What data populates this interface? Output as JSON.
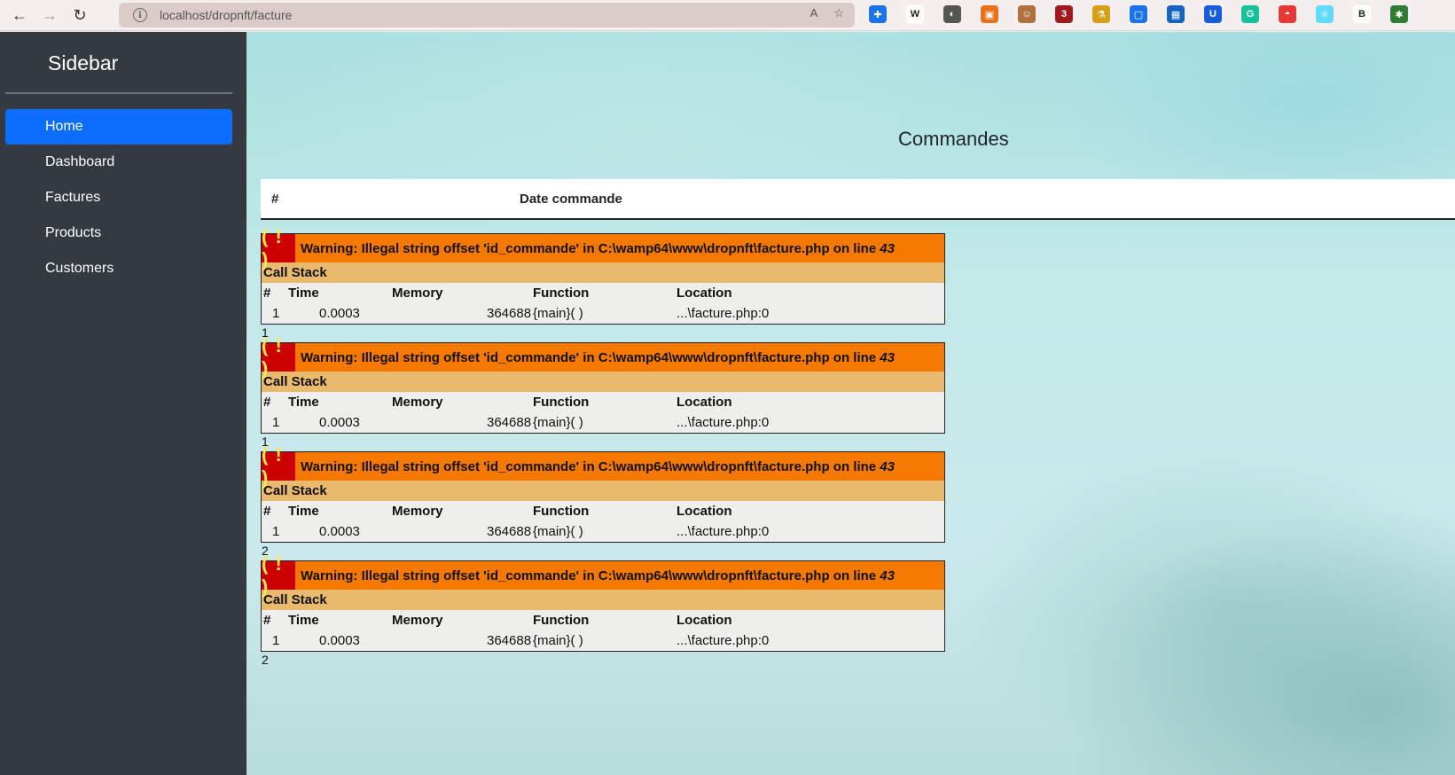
{
  "browser": {
    "url": "localhost/dropnft/facture",
    "back_icon": "←",
    "forward_icon": "→",
    "reload_icon": "↻",
    "extensions": [
      {
        "name": "ext-blue",
        "color": "#1a73e8",
        "glyph": "✚"
      },
      {
        "name": "ext-wikipedia",
        "color": "#ffffff",
        "glyph": "W"
      },
      {
        "name": "ext-gray",
        "color": "#555555",
        "glyph": "◐"
      },
      {
        "name": "ext-orange",
        "color": "#e8711a",
        "glyph": "▣"
      },
      {
        "name": "ext-face",
        "color": "#b07040",
        "glyph": "☺"
      },
      {
        "name": "ext-ublock",
        "color": "#a0191c",
        "glyph": "3"
      },
      {
        "name": "ext-flask",
        "color": "#d4a017",
        "glyph": "⚗"
      },
      {
        "name": "ext-screen",
        "color": "#1a73e8",
        "glyph": "▢"
      },
      {
        "name": "ext-grid",
        "color": "#1565c0",
        "glyph": "▦"
      },
      {
        "name": "ext-bitwarden",
        "color": "#175ddc",
        "glyph": "U"
      },
      {
        "name": "ext-grammarly",
        "color": "#15c39a",
        "glyph": "G"
      },
      {
        "name": "ext-poke",
        "color": "#e53935",
        "glyph": "◓"
      },
      {
        "name": "ext-react",
        "color": "#61dafb",
        "glyph": "⚛"
      },
      {
        "name": "ext-b",
        "color": "#ffffff",
        "glyph": "B"
      },
      {
        "name": "ext-puzzle",
        "color": "#2e7d32",
        "glyph": "✱"
      }
    ]
  },
  "sidebar": {
    "title": "Sidebar",
    "items": [
      {
        "label": "Home",
        "active": true
      },
      {
        "label": "Dashboard",
        "active": false
      },
      {
        "label": "Factures",
        "active": false
      },
      {
        "label": "Products",
        "active": false
      },
      {
        "label": "Customers",
        "active": false
      }
    ]
  },
  "main": {
    "title": "Commandes",
    "table_headers": [
      "#",
      "Date commande"
    ]
  },
  "warnings": [
    {
      "icon": "( ! )",
      "message_prefix": "Warning: Illegal string offset 'id_commande' in C:\\wamp64\\www\\dropnft\\facture.php on line ",
      "line": "43",
      "call_stack_label": "Call Stack",
      "stack_headers": [
        "#",
        "Time",
        "Memory",
        "Function",
        "Location"
      ],
      "stack_row": [
        "1",
        "0.0003",
        "364688",
        "{main}( )",
        "...\\facture.php:0"
      ],
      "after_text": "1"
    },
    {
      "icon": "( ! )",
      "message_prefix": "Warning: Illegal string offset 'id_commande' in C:\\wamp64\\www\\dropnft\\facture.php on line ",
      "line": "43",
      "call_stack_label": "Call Stack",
      "stack_headers": [
        "#",
        "Time",
        "Memory",
        "Function",
        "Location"
      ],
      "stack_row": [
        "1",
        "0.0003",
        "364688",
        "{main}( )",
        "...\\facture.php:0"
      ],
      "after_text": "1"
    },
    {
      "icon": "( ! )",
      "message_prefix": "Warning: Illegal string offset 'id_commande' in C:\\wamp64\\www\\dropnft\\facture.php on line ",
      "line": "43",
      "call_stack_label": "Call Stack",
      "stack_headers": [
        "#",
        "Time",
        "Memory",
        "Function",
        "Location"
      ],
      "stack_row": [
        "1",
        "0.0003",
        "364688",
        "{main}( )",
        "...\\facture.php:0"
      ],
      "after_text": "2"
    },
    {
      "icon": "( ! )",
      "message_prefix": "Warning: Illegal string offset 'id_commande' in C:\\wamp64\\www\\dropnft\\facture.php on line ",
      "line": "43",
      "call_stack_label": "Call Stack",
      "stack_headers": [
        "#",
        "Time",
        "Memory",
        "Function",
        "Location"
      ],
      "stack_row": [
        "1",
        "0.0003",
        "364688",
        "{main}( )",
        "...\\facture.php:0"
      ],
      "after_text": "2"
    }
  ]
}
